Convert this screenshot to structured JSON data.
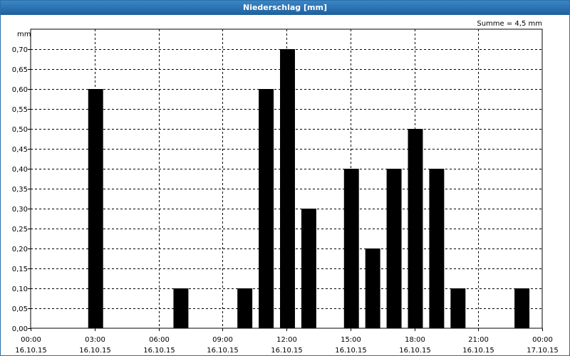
{
  "window": {
    "title": "Niederschlag [mm]"
  },
  "summary": "Summe = 4,5 mm",
  "chart_data": {
    "type": "bar",
    "title": "Niederschlag [mm]",
    "ylabel": "mm",
    "ylim": [
      0,
      0.75
    ],
    "yticks": [
      "0,00",
      "0,05",
      "0,10",
      "0,15",
      "0,20",
      "0,25",
      "0,30",
      "0,35",
      "0,40",
      "0,45",
      "0,50",
      "0,55",
      "0,60",
      "0,65",
      "0,70"
    ],
    "xlim": [
      0,
      24
    ],
    "xticks": [
      {
        "time": "00:00",
        "date": "16.10.15"
      },
      {
        "time": "03:00",
        "date": "16.10.15"
      },
      {
        "time": "06:00",
        "date": "16.10.15"
      },
      {
        "time": "09:00",
        "date": "16.10.15"
      },
      {
        "time": "12:00",
        "date": "16.10.15"
      },
      {
        "time": "15:00",
        "date": "16.10.15"
      },
      {
        "time": "18:00",
        "date": "16.10.15"
      },
      {
        "time": "21:00",
        "date": "16.10.15"
      },
      {
        "time": "00:00",
        "date": "17.10.15"
      }
    ],
    "grid": true,
    "bar_color": "#000000",
    "bars": [
      {
        "hour": 3,
        "value": 0.6
      },
      {
        "hour": 7,
        "value": 0.1
      },
      {
        "hour": 10,
        "value": 0.1
      },
      {
        "hour": 11,
        "value": 0.6
      },
      {
        "hour": 12,
        "value": 0.7
      },
      {
        "hour": 13,
        "value": 0.3
      },
      {
        "hour": 15,
        "value": 0.4
      },
      {
        "hour": 16,
        "value": 0.2
      },
      {
        "hour": 17,
        "value": 0.4
      },
      {
        "hour": 18,
        "value": 0.5
      },
      {
        "hour": 19,
        "value": 0.4
      },
      {
        "hour": 20,
        "value": 0.1
      },
      {
        "hour": 23,
        "value": 0.1
      }
    ]
  }
}
